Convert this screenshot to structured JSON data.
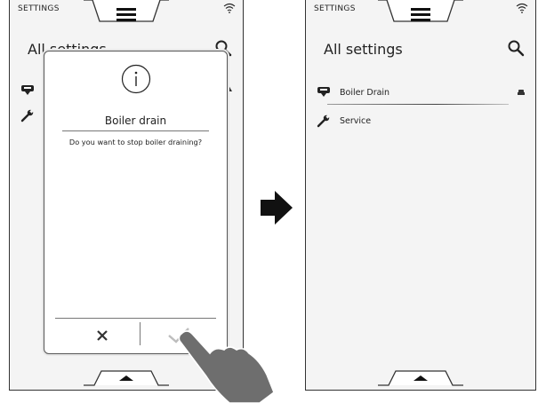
{
  "left_screen": {
    "status_label": "SETTINGS",
    "page_title": "All settings",
    "dialog": {
      "title": "Boiler drain",
      "message": "Do you want to stop boiler draining?"
    }
  },
  "right_screen": {
    "status_label": "SETTINGS",
    "page_title": "All settings",
    "items": [
      {
        "label": "Boiler Drain",
        "icon": "boiler-drain-icon"
      },
      {
        "label": "Service",
        "icon": "wrench-icon"
      }
    ]
  },
  "icons": {
    "menu": "hamburger-menu-icon",
    "wifi": "wifi-icon",
    "search": "search-icon",
    "info": "info-icon",
    "cancel": "cross-icon",
    "confirm": "check-icon",
    "scroll": "triangle-up-icon"
  },
  "colors": {
    "screen_bg": "#f4f4f4",
    "dialog_bg": "#ffffff",
    "arrow": "#111111",
    "hand": "#6e6e6e"
  }
}
